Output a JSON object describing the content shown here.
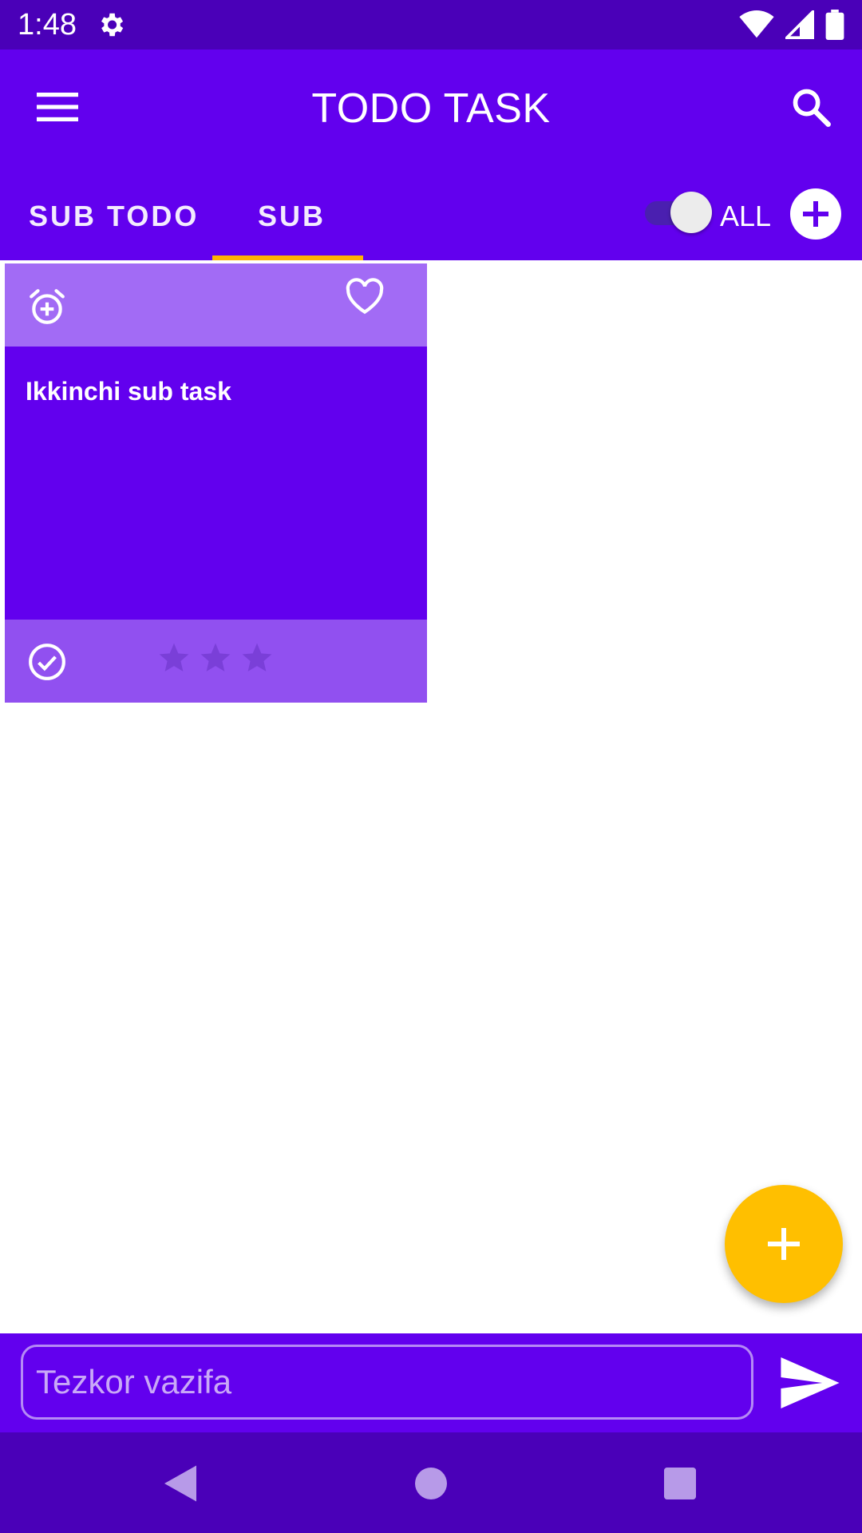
{
  "status_bar": {
    "time": "1:48"
  },
  "app_bar": {
    "title": "TODO TASK"
  },
  "tabs": [
    {
      "label": "SUB TODO",
      "selected": false
    },
    {
      "label": "SUB",
      "selected": true
    }
  ],
  "filter": {
    "toggle_on": true,
    "label": "ALL"
  },
  "card": {
    "title": "Ikkinchi sub task",
    "favorite": false,
    "rating_stars": 3,
    "rating_filled": 0
  },
  "quick_task": {
    "value": "",
    "placeholder": "Tezkor vazifa"
  },
  "colors": {
    "primary": "#6200ee",
    "primary_dark": "#4a00b8",
    "accent": "#ffb300",
    "fab": "#ffbf00",
    "card_top": "#a26bf5",
    "card_bottom": "#9150f0"
  }
}
